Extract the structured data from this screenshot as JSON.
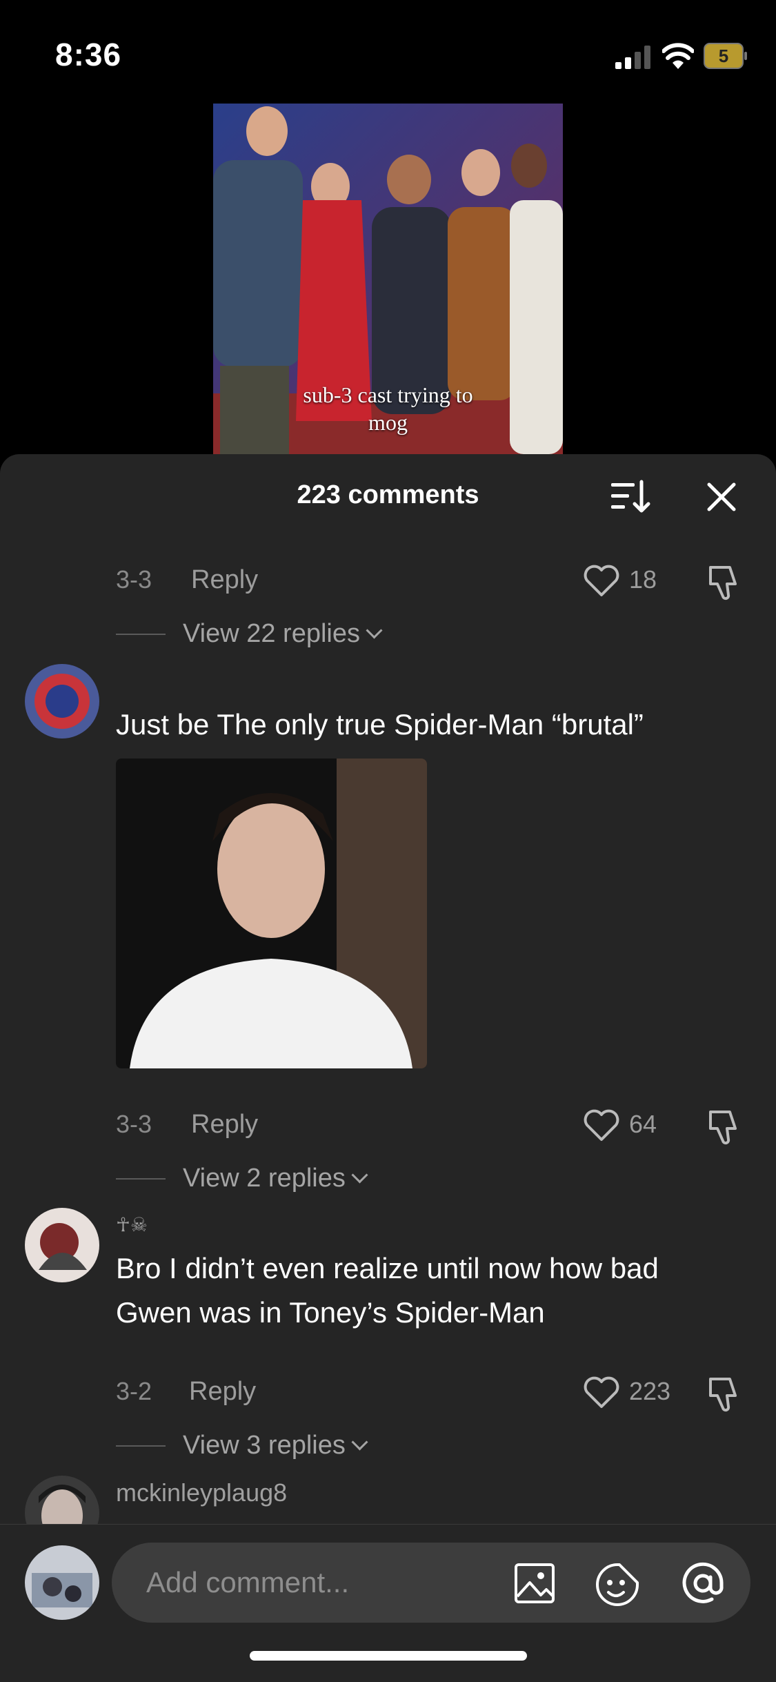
{
  "status_bar": {
    "time": "8:36",
    "battery": "5"
  },
  "video": {
    "caption_line1": "sub-3 cast trying to",
    "caption_line2": "mog"
  },
  "comments_sheet": {
    "title": "223 comments",
    "comments": [
      {
        "date": "3-3",
        "reply_label": "Reply",
        "likes": "18",
        "view_replies": "View 22 replies"
      },
      {
        "text": "Just be The only true Spider-Man “brutal”",
        "date": "3-3",
        "reply_label": "Reply",
        "likes": "64",
        "view_replies": "View 2 replies"
      },
      {
        "username": "☥☠",
        "text_line1": "Bro I didn’t even realize until now how bad",
        "text_line2": "Gwen was in Toney’s Spider-Man",
        "date": "3-2",
        "reply_label": "Reply",
        "likes": "223",
        "view_replies": "View 3 replies"
      },
      {
        "username": "mckinleyplaug8"
      }
    ]
  },
  "composer": {
    "placeholder": "Add comment..."
  },
  "icons": [
    "signal-icon",
    "wifi-icon",
    "battery-icon",
    "sort-icon",
    "close-icon",
    "heart-icon",
    "dislike-icon",
    "chevron-down-icon",
    "image-icon",
    "sticker-icon",
    "at-icon"
  ]
}
